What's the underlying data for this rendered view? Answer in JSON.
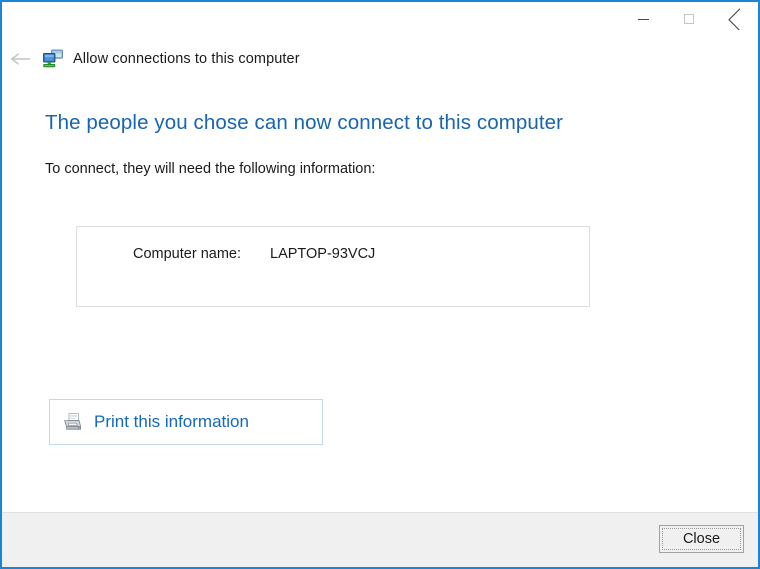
{
  "window": {
    "title": "Allow connections to this computer",
    "app_icon": "remote-connection-icon",
    "border_color": "#1a84d6",
    "controls": {
      "minimize_label": "Minimize",
      "maximize_label": "Maximize",
      "close_label": "Close"
    },
    "back_label": "Back"
  },
  "content": {
    "heading": "The people you chose can now connect to this computer",
    "heading_color": "#1765b0",
    "subtext": "To connect, they will need the following information:",
    "info": {
      "label": "Computer name:",
      "value": "LAPTOP-93VCJ"
    },
    "print_button": {
      "label": "Print this information",
      "icon": "printer-icon",
      "color": "#1569b8"
    }
  },
  "footer": {
    "close_button": "Close"
  }
}
